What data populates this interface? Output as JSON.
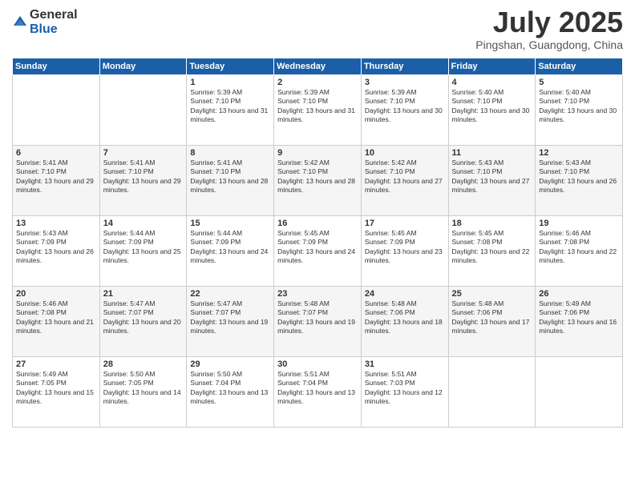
{
  "logo": {
    "general": "General",
    "blue": "Blue"
  },
  "header": {
    "month_year": "July 2025",
    "location": "Pingshan, Guangdong, China"
  },
  "weekdays": [
    "Sunday",
    "Monday",
    "Tuesday",
    "Wednesday",
    "Thursday",
    "Friday",
    "Saturday"
  ],
  "weeks": [
    [
      {
        "day": "",
        "info": ""
      },
      {
        "day": "",
        "info": ""
      },
      {
        "day": "1",
        "info": "Sunrise: 5:39 AM\nSunset: 7:10 PM\nDaylight: 13 hours and 31 minutes."
      },
      {
        "day": "2",
        "info": "Sunrise: 5:39 AM\nSunset: 7:10 PM\nDaylight: 13 hours and 31 minutes."
      },
      {
        "day": "3",
        "info": "Sunrise: 5:39 AM\nSunset: 7:10 PM\nDaylight: 13 hours and 30 minutes."
      },
      {
        "day": "4",
        "info": "Sunrise: 5:40 AM\nSunset: 7:10 PM\nDaylight: 13 hours and 30 minutes."
      },
      {
        "day": "5",
        "info": "Sunrise: 5:40 AM\nSunset: 7:10 PM\nDaylight: 13 hours and 30 minutes."
      }
    ],
    [
      {
        "day": "6",
        "info": "Sunrise: 5:41 AM\nSunset: 7:10 PM\nDaylight: 13 hours and 29 minutes."
      },
      {
        "day": "7",
        "info": "Sunrise: 5:41 AM\nSunset: 7:10 PM\nDaylight: 13 hours and 29 minutes."
      },
      {
        "day": "8",
        "info": "Sunrise: 5:41 AM\nSunset: 7:10 PM\nDaylight: 13 hours and 28 minutes."
      },
      {
        "day": "9",
        "info": "Sunrise: 5:42 AM\nSunset: 7:10 PM\nDaylight: 13 hours and 28 minutes."
      },
      {
        "day": "10",
        "info": "Sunrise: 5:42 AM\nSunset: 7:10 PM\nDaylight: 13 hours and 27 minutes."
      },
      {
        "day": "11",
        "info": "Sunrise: 5:43 AM\nSunset: 7:10 PM\nDaylight: 13 hours and 27 minutes."
      },
      {
        "day": "12",
        "info": "Sunrise: 5:43 AM\nSunset: 7:10 PM\nDaylight: 13 hours and 26 minutes."
      }
    ],
    [
      {
        "day": "13",
        "info": "Sunrise: 5:43 AM\nSunset: 7:09 PM\nDaylight: 13 hours and 26 minutes."
      },
      {
        "day": "14",
        "info": "Sunrise: 5:44 AM\nSunset: 7:09 PM\nDaylight: 13 hours and 25 minutes."
      },
      {
        "day": "15",
        "info": "Sunrise: 5:44 AM\nSunset: 7:09 PM\nDaylight: 13 hours and 24 minutes."
      },
      {
        "day": "16",
        "info": "Sunrise: 5:45 AM\nSunset: 7:09 PM\nDaylight: 13 hours and 24 minutes."
      },
      {
        "day": "17",
        "info": "Sunrise: 5:45 AM\nSunset: 7:09 PM\nDaylight: 13 hours and 23 minutes."
      },
      {
        "day": "18",
        "info": "Sunrise: 5:45 AM\nSunset: 7:08 PM\nDaylight: 13 hours and 22 minutes."
      },
      {
        "day": "19",
        "info": "Sunrise: 5:46 AM\nSunset: 7:08 PM\nDaylight: 13 hours and 22 minutes."
      }
    ],
    [
      {
        "day": "20",
        "info": "Sunrise: 5:46 AM\nSunset: 7:08 PM\nDaylight: 13 hours and 21 minutes."
      },
      {
        "day": "21",
        "info": "Sunrise: 5:47 AM\nSunset: 7:07 PM\nDaylight: 13 hours and 20 minutes."
      },
      {
        "day": "22",
        "info": "Sunrise: 5:47 AM\nSunset: 7:07 PM\nDaylight: 13 hours and 19 minutes."
      },
      {
        "day": "23",
        "info": "Sunrise: 5:48 AM\nSunset: 7:07 PM\nDaylight: 13 hours and 19 minutes."
      },
      {
        "day": "24",
        "info": "Sunrise: 5:48 AM\nSunset: 7:06 PM\nDaylight: 13 hours and 18 minutes."
      },
      {
        "day": "25",
        "info": "Sunrise: 5:48 AM\nSunset: 7:06 PM\nDaylight: 13 hours and 17 minutes."
      },
      {
        "day": "26",
        "info": "Sunrise: 5:49 AM\nSunset: 7:06 PM\nDaylight: 13 hours and 16 minutes."
      }
    ],
    [
      {
        "day": "27",
        "info": "Sunrise: 5:49 AM\nSunset: 7:05 PM\nDaylight: 13 hours and 15 minutes."
      },
      {
        "day": "28",
        "info": "Sunrise: 5:50 AM\nSunset: 7:05 PM\nDaylight: 13 hours and 14 minutes."
      },
      {
        "day": "29",
        "info": "Sunrise: 5:50 AM\nSunset: 7:04 PM\nDaylight: 13 hours and 13 minutes."
      },
      {
        "day": "30",
        "info": "Sunrise: 5:51 AM\nSunset: 7:04 PM\nDaylight: 13 hours and 13 minutes."
      },
      {
        "day": "31",
        "info": "Sunrise: 5:51 AM\nSunset: 7:03 PM\nDaylight: 13 hours and 12 minutes."
      },
      {
        "day": "",
        "info": ""
      },
      {
        "day": "",
        "info": ""
      }
    ]
  ]
}
